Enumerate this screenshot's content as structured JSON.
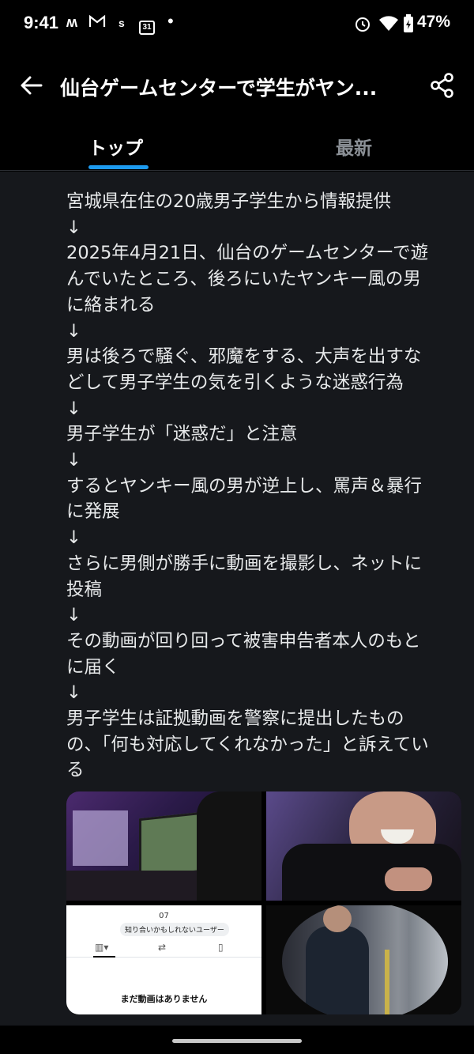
{
  "status_bar": {
    "time": "9:41",
    "icons": [
      "m-icon",
      "gmail-icon",
      "s-icon",
      "calendar-icon",
      "dot-icon"
    ],
    "calendar_day": "31",
    "s_label": "s",
    "battery": "47%"
  },
  "appbar": {
    "title": "仙台ゲームセンターで学生がヤン..."
  },
  "tabs": [
    {
      "label": "トップ",
      "active": true
    },
    {
      "label": "最新",
      "active": false
    }
  ],
  "post": {
    "lines": [
      "宮城県在住の20歳男子学生から情報提供",
      "↓",
      "2025年4月21日、仙台のゲームセンターで遊",
      "んでいたところ、後ろにいたヤンキー風の男",
      "に絡まれる",
      "↓",
      "男は後ろで騒ぐ、邪魔をする、大声を出すな",
      "どして男子学生の気を引くような迷惑行為",
      "↓",
      "男子学生が「迷惑だ」と注意",
      "↓",
      "するとヤンキー風の男が逆上し、罵声＆暴行",
      "に発展",
      "↓",
      "さらに男側が勝手に動画を撮影し、ネットに",
      "投稿",
      "↓",
      "その動画が回り回って被害申告者本人のもと",
      "に届く",
      "↓",
      "男子学生は証拠動画を警察に提出したもの",
      "の、「何も対応してくれなかった」と訴えてい",
      "る"
    ]
  },
  "media": {
    "m3_number": "07",
    "m3_chip": "知り合いかもしれないユーザー",
    "m3_empty": "まだ動画はありません"
  },
  "colors": {
    "accent": "#1d9bf0",
    "background": "#16181c"
  }
}
